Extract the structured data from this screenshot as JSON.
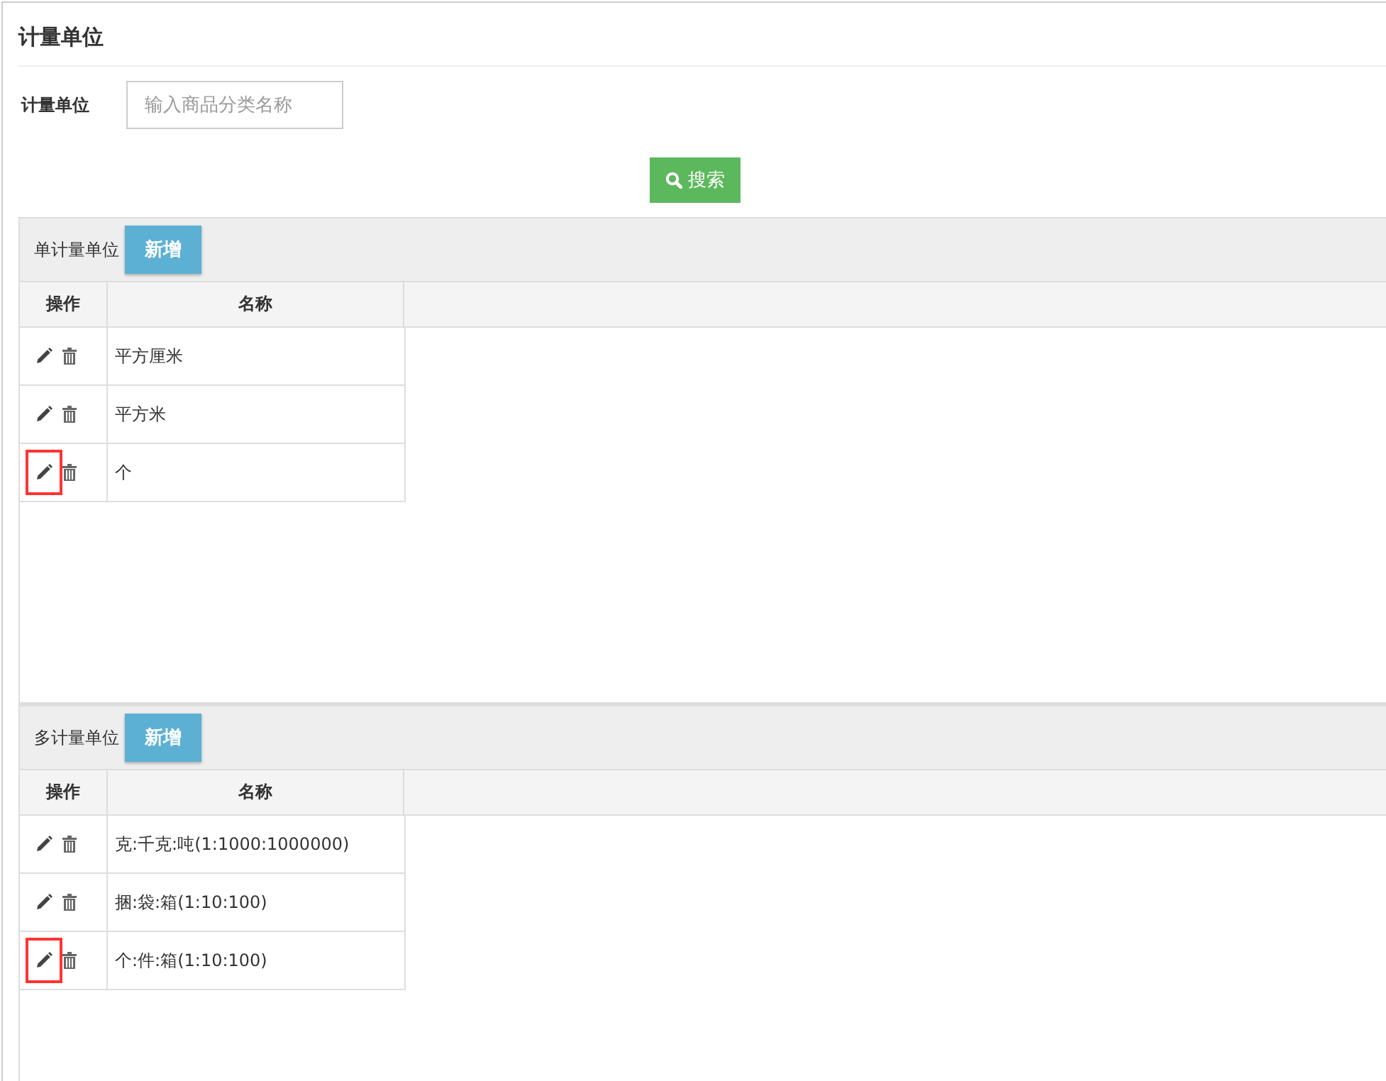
{
  "page_title": "计量单位",
  "filter": {
    "label": "计量单位",
    "placeholder": "输入商品分类名称"
  },
  "search_button": "搜索",
  "panels": [
    {
      "title": "单计量单位",
      "add_button": "新增",
      "columns": [
        "操作",
        "名称"
      ],
      "rows": [
        {
          "name": "平方厘米",
          "highlighted": false
        },
        {
          "name": "平方米",
          "highlighted": false
        },
        {
          "name": "个",
          "highlighted": true
        }
      ]
    },
    {
      "title": "多计量单位",
      "add_button": "新增",
      "columns": [
        "操作",
        "名称"
      ],
      "rows": [
        {
          "name": "克:千克:吨(1:1000:1000000)",
          "highlighted": false
        },
        {
          "name": "捆:袋:箱(1:10:100)",
          "highlighted": false
        },
        {
          "name": "个:件:箱(1:10:100)",
          "highlighted": true
        }
      ]
    }
  ]
}
